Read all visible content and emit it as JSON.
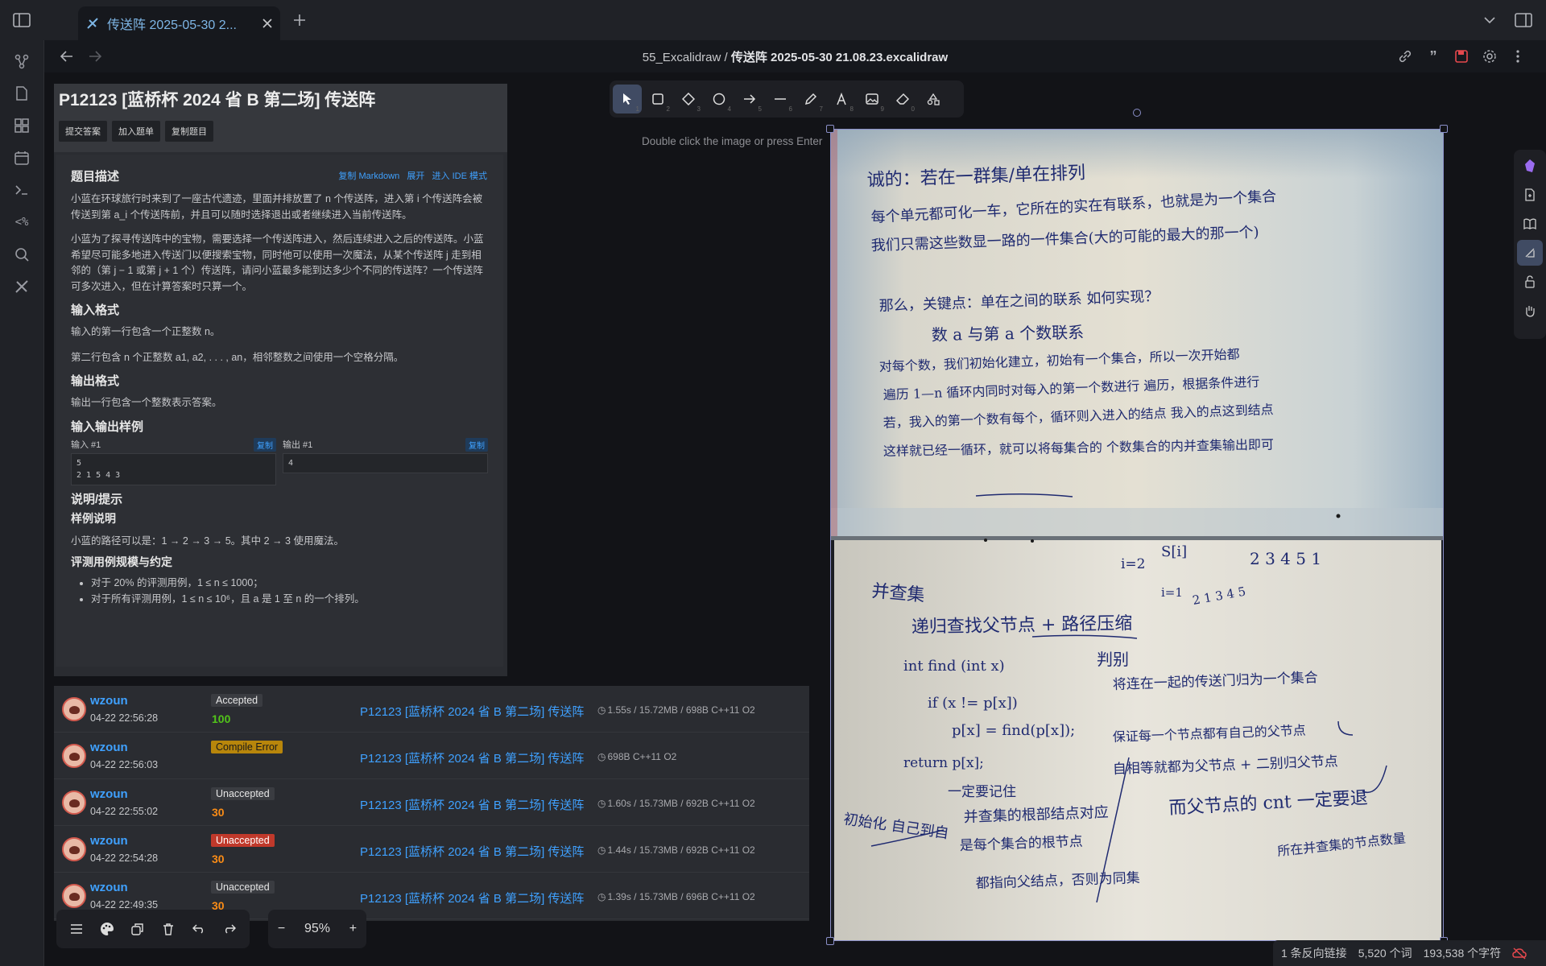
{
  "tab": {
    "title": "传送阵 2025-05-30 2..."
  },
  "breadcrumb": {
    "folder": "55_Excalidraw",
    "sep": "/",
    "file": "传送阵 2025-05-30 21.08.23.excalidraw"
  },
  "problem": {
    "title": "P12123 [蓝桥杯 2024 省 B 第二场] 传送阵",
    "buttons": [
      "提交答案",
      "加入题单",
      "复制题目"
    ],
    "desc_heading": "题目描述",
    "links": [
      "复制 Markdown",
      "展开",
      "进入 IDE 模式"
    ],
    "desc_p1": "小蓝在环球旅行时来到了一座古代遗迹，里面并排放置了 n 个传送阵，进入第 i 个传送阵会被传送到第 a_i 个传送阵前，并且可以随时选择退出或者继续进入当前传送阵。",
    "desc_p2": "小蓝为了探寻传送阵中的宝物，需要选择一个传送阵进入，然后连续进入之后的传送阵。小蓝希望尽可能多地进入传送门以便搜索宝物，同时他可以使用一次魔法，从某个传送阵 j 走到相邻的（第 j − 1 或第 j + 1 个）传送阵，请问小蓝最多能到达多少个不同的传送阵？一个传送阵可多次进入，但在计算答案时只算一个。",
    "input_heading": "输入格式",
    "input_p1": "输入的第一行包含一个正整数 n。",
    "input_p2": "第二行包含 n 个正整数 a1, a2, . . . , an，相邻整数之间使用一个空格分隔。",
    "output_heading": "输出格式",
    "output_p": "输出一行包含一个整数表示答案。",
    "sample_heading": "输入输出样例",
    "in_label": "输入 #1",
    "out_label": "输出 #1",
    "copy_label": "复制",
    "in_line1": "5",
    "in_line2": "2 1 5 4 3",
    "out_line1": "4",
    "hint_heading": "说明/提示",
    "sample_expl_heading": "样例说明",
    "sample_expl": "小蓝的路径可以是：1 → 2 → 3 → 5。其中 2 → 3 使用魔法。",
    "limits_heading": "评测用例规模与约定",
    "limit1": "对于 20% 的评测用例，1 ≤ n ≤ 1000；",
    "limit2": "对于所有评测用例，1 ≤ n ≤ 10⁶，且 a 是 1 至 n 的一个排列。"
  },
  "submissions": [
    {
      "user": "wzoun",
      "time": "04-22 22:56:28",
      "status": "Accepted",
      "status_color": "#2a2c31",
      "score": "100",
      "score_color": "#52c41a",
      "problem": "P12123 [蓝桥杯 2024 省 B 第二场] 传送阵",
      "meta": "1.55s / 15.72MB / 698B C++11 O2"
    },
    {
      "user": "wzoun",
      "time": "04-22 22:56:03",
      "status": "Compile Error",
      "status_color": "#b8860b",
      "score": "",
      "score_color": "#fa8c16",
      "problem": "P12123 [蓝桥杯 2024 省 B 第二场] 传送阵",
      "meta": "698B C++11 O2"
    },
    {
      "user": "wzoun",
      "time": "04-22 22:55:02",
      "status": "Unaccepted",
      "status_color": "#2a2c31",
      "score": "30",
      "score_color": "#fa8c16",
      "problem": "P12123 [蓝桥杯 2024 省 B 第二场] 传送阵",
      "meta": "1.60s / 15.73MB / 692B C++11 O2"
    },
    {
      "user": "wzoun",
      "time": "04-22 22:54:28",
      "status": "Unaccepted",
      "status_color": "#c0392b",
      "score": "30",
      "score_color": "#fa8c16",
      "problem": "P12123 [蓝桥杯 2024 省 B 第二场] 传送阵",
      "meta": "1.44s / 15.73MB / 692B C++11 O2"
    },
    {
      "user": "wzoun",
      "time": "04-22 22:49:35",
      "status": "Unaccepted",
      "status_color": "#2a2c31",
      "score": "30",
      "score_color": "#fa8c16",
      "problem": "P12123 [蓝桥杯 2024 省 B 第二场] 传送阵",
      "meta": "1.39s / 15.73MB / 696B C++11 O2"
    }
  ],
  "canvas": {
    "hint": "Double click the image or press Enter"
  },
  "zoom": {
    "minus": "−",
    "value": "95%",
    "plus": "+"
  },
  "statusbar": {
    "backlinks": "1 条反向链接",
    "words": "5,520 个词",
    "chars": "193,538 个字符"
  },
  "notes": {
    "l1": "诚的：若在一群集/单在排列",
    "l2": "每个单元都可化一车，它所在的实在有联系，也就是为一个集合",
    "l3": "我们只需这些数显一路的一件集合(大的可能的最大的那一个)",
    "l4": "那么，关键点：单在之间的联系 如何实现？",
    "l5": "数 a 与第 a 个数联系",
    "l6": "对每个数，我们初始化建立，初始有一个集合，所以一次开始都",
    "l7": "遍历 1—n 循环内同时对每入的第一个数进行 遍历，根据条件进行",
    "l8": "若，我入的第一个数有每个，循环则入进入的结点 我入的点这到结点",
    "l9": "这样就已经一循环，就可以将每集合的 个数集合的内并查集输出即可",
    "m1": "并查集",
    "m2": "递归查找父节点 + 路径压缩",
    "m3": "int find (int x)",
    "m4": "if (x != p[x])",
    "m5": "p[x] = find(p[x]);",
    "m6": "return p[x];",
    "m7": "一定要记住",
    "m8": "初始化 自己到自",
    "m9": "并查集的根部结点对应",
    "m10": "是每个集合的根节点",
    "m11": "都指向父结点，否则为同集",
    "r1": "i=2",
    "r2": "S[i]",
    "r3": "2 3 4 5 1",
    "r4": "i=1",
    "r5": "2 1 3 4 5",
    "r6": "判别",
    "r7": "将连在一起的传送门归为一个集合",
    "r8": "保证每一个节点都有自己的父节点",
    "r9": "自相等就都为父节点 + 二别归父节点",
    "r10": "而父节点的 cnt 一定要退",
    "r11": "所在并查集的节点数量"
  }
}
